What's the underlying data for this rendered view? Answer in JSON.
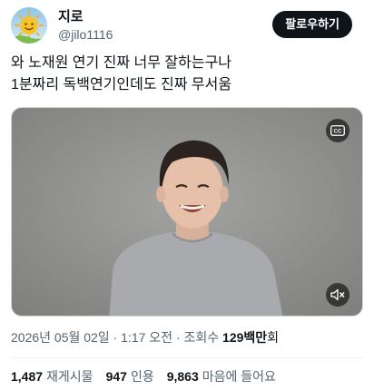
{
  "user": {
    "display_name": "지로",
    "handle": "@jilo1116",
    "follow_label": "팔로우하기"
  },
  "tweet": {
    "lines": [
      "와 노재원 연기 진짜 너무 잘하는구나",
      "1분짜리 독백연기인데도 진짜 무서움"
    ]
  },
  "media": {
    "type": "video",
    "cc_icon": "closed-captions-icon",
    "mute_icon": "speaker-muted-icon"
  },
  "meta": {
    "timestamp": "2026년 05월 02일 · 1:17 오전 · 조회수 ",
    "views_number": "129백만",
    "views_unit": "회"
  },
  "stats": {
    "reposts_count": "1,487",
    "reposts_label": "재게시물",
    "quotes_count": "947",
    "quotes_label": "인용",
    "likes_count": "9,863",
    "likes_label": "마음에 들어요"
  },
  "colors": {
    "text_primary": "#0f1419",
    "text_secondary": "#536471",
    "button_bg": "#0f1419",
    "button_text": "#ffffff",
    "divider": "#eff3f4"
  }
}
